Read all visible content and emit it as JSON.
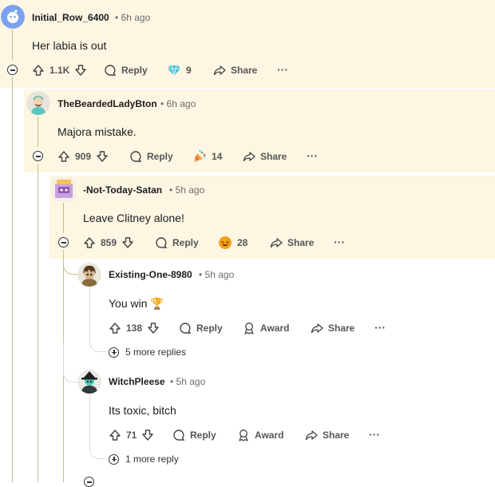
{
  "comments": [
    {
      "username": "Initial_Row_6400",
      "time": "6h ago",
      "text": "Her labia is out",
      "votes": "1.1K",
      "award_count": "9",
      "award_icon": "diamond-award-icon",
      "reply_label": "Reply",
      "share_label": "Share",
      "more_label": "···"
    },
    {
      "username": "TheBeardedLadyBton",
      "time": "6h ago",
      "text": "Majora mistake.",
      "votes": "909",
      "award_count": "14",
      "award_icon": "party-popper-award-icon",
      "reply_label": "Reply",
      "share_label": "Share",
      "more_label": "···"
    },
    {
      "username": "-Not-Today-Satan",
      "time": "5h ago",
      "text": "Leave Clitney alone!",
      "votes": "859",
      "award_count": "28",
      "award_icon": "laughing-face-award-icon",
      "reply_label": "Reply",
      "share_label": "Share",
      "more_label": "···"
    },
    {
      "username": "Existing-One-8980",
      "time": "5h ago",
      "text": "You win 🏆",
      "votes": "138",
      "reply_label": "Reply",
      "award_label": "Award",
      "share_label": "Share",
      "more_label": "···",
      "more_replies": "5 more replies"
    },
    {
      "username": "WitchPleese",
      "time": "5h ago",
      "text": "Its toxic, bitch",
      "votes": "71",
      "reply_label": "Reply",
      "award_label": "Award",
      "share_label": "Share",
      "more_label": "···",
      "more_replies": "1 more reply"
    }
  ],
  "separator": "•",
  "colors": {
    "highlight_bg": "#fdf6e3",
    "thread_line": "#c8bf8a",
    "thread_line_gray": "#d9d9d9",
    "text": "#1c1c1c",
    "meta": "#6b6b6b"
  }
}
